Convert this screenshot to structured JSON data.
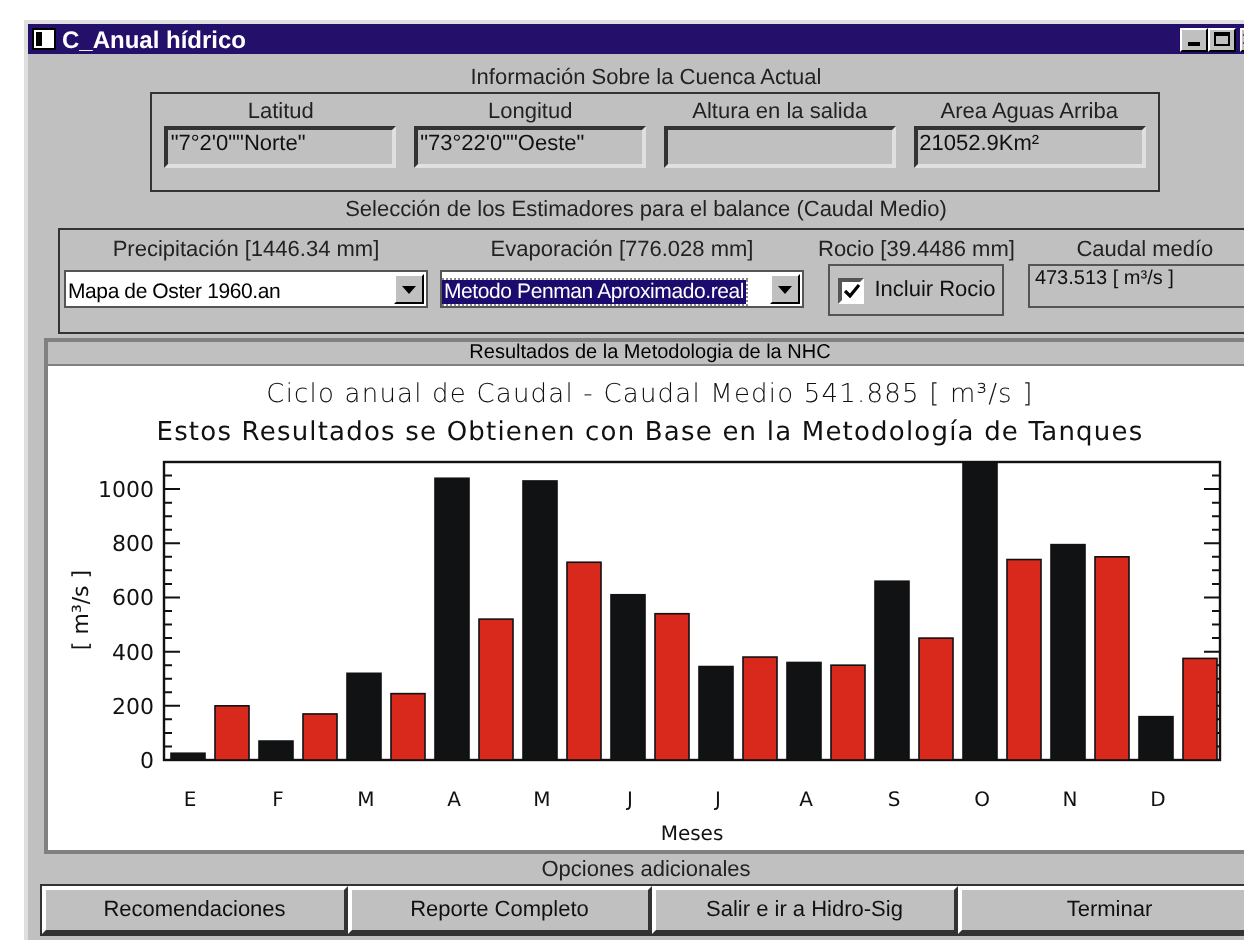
{
  "window": {
    "title": "C_Anual hídrico"
  },
  "cuenca": {
    "title": "Información Sobre la Cuenca Actual",
    "fields": [
      {
        "label": "Latitud",
        "value": "\"7°2'0\"\"Norte\""
      },
      {
        "label": "Longitud",
        "value": "\"73°22'0\"\"Oeste\""
      },
      {
        "label": "Altura en la salida"
      },
      {
        "label": "Area Aguas Arriba",
        "value": "21052.9Km²"
      }
    ]
  },
  "estimadores": {
    "title": "Selección de los Estimadores para el balance (Caudal Medio)",
    "precipitacion": {
      "label": "Precipitación [1446.34 mm]",
      "value": "Mapa de Oster 1960.an",
      "selected": false
    },
    "evaporacion": {
      "label": "Evaporación [776.028 mm]",
      "value": "Metodo Penman Aproximado.real",
      "selected": true
    },
    "rocio": {
      "label": "Rocio [39.4486 mm]",
      "checkbox": "Incluir Rocio",
      "checked": true
    },
    "caudal": {
      "label": "Caudal medío",
      "value": "473.513 [ m³/s ]"
    }
  },
  "resultados": {
    "title": "Resultados de la Metodologia de la NHC",
    "chart_data": {
      "type": "bar",
      "title": "Ciclo anual de Caudal - Caudal Medio 541.885 [ m³/s ]",
      "subtitle": "Estos Resultados se Obtienen con Base en la Metodología de Tanques",
      "xlabel": "Meses",
      "ylabel": "[ m³/s ]",
      "categories": [
        "E",
        "F",
        "M",
        "A",
        "M",
        "J",
        "J",
        "A",
        "S",
        "O",
        "N",
        "D"
      ],
      "series": [
        {
          "color": "#111214",
          "values": [
            25,
            70,
            320,
            1040,
            1030,
            610,
            345,
            360,
            660,
            1100,
            795,
            160
          ]
        },
        {
          "color": "#d9281c",
          "values": [
            200,
            170,
            245,
            520,
            730,
            540,
            380,
            350,
            450,
            740,
            750,
            375
          ]
        }
      ],
      "ylim": [
        0,
        1100
      ],
      "yticks": [
        0,
        200,
        400,
        600,
        800,
        1000
      ]
    }
  },
  "opciones": {
    "title": "Opciones adicionales",
    "buttons": [
      "Recomendaciones",
      "Reporte Completo",
      "Salir e ir a Hidro-Sig",
      "Terminar"
    ]
  }
}
